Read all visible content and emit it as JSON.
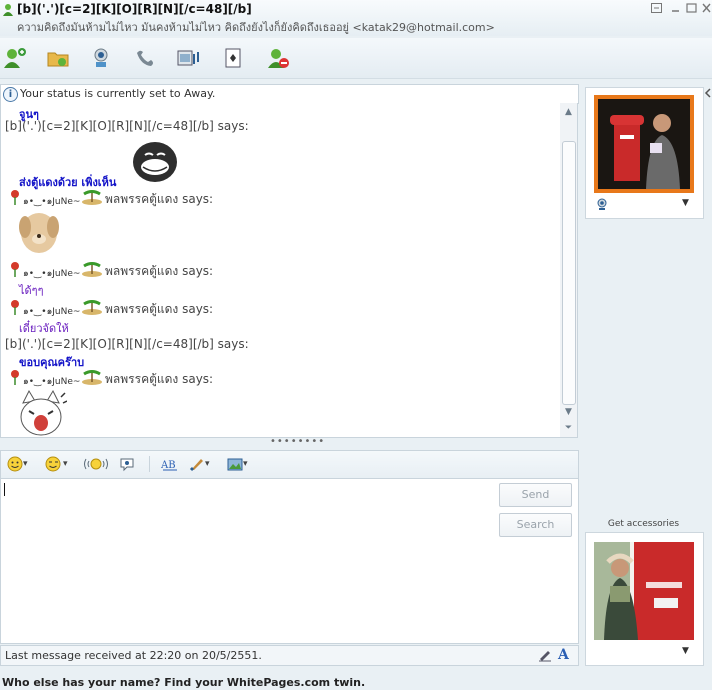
{
  "window": {
    "title": "[b]('.')[c=2][K][O][R][N][/c=48][/b]",
    "subtitle": "ความคิดถึงมันห้ามไม่ไหว มันคงห้ามไม่ไหว คิดถึงยังไงก็ยังคิดถึงเธออยู่ <katak29@hotmail.com>",
    "controls": [
      "restore-icon",
      "minimize-icon",
      "maximize-icon",
      "close-icon"
    ]
  },
  "toolbar": {
    "buttons": [
      {
        "name": "invite-contact",
        "icon": "add-contact-icon"
      },
      {
        "name": "send-files",
        "icon": "folder-icon"
      },
      {
        "name": "video-call",
        "icon": "webcam-icon"
      },
      {
        "name": "voice-call",
        "icon": "phone-icon"
      },
      {
        "name": "activities",
        "icon": "film-icon"
      },
      {
        "name": "games",
        "icon": "playing-card-icon"
      },
      {
        "name": "block",
        "icon": "block-contact-icon"
      }
    ]
  },
  "status": {
    "text": "Your status is currently set to Away."
  },
  "conversation": {
    "me_says": "[b]('.')[c=2][K][O][R][N][/c=48][/b] says:",
    "contact_name": "๑•‿•๑JuNe~",
    "contact_says": "พลพรรคตู้แดง says:",
    "messages": {
      "m1": "จูนๆ",
      "m2": "ส่งตู้แดงด้วย เพิ่งเห็น",
      "m3": "ได้ๆๆ",
      "m4": "เดี๋ยวจัดให้",
      "m5": "ขอบคุณคร๊าบ"
    }
  },
  "format_toolbar": {
    "buttons": [
      "emoticon-icon",
      "wink-icon",
      "nudge-icon",
      "voice-clip-icon",
      "text-format-icon",
      "background-icon",
      "picture-icon"
    ]
  },
  "compose": {
    "send_label": "Send",
    "search_label": "Search"
  },
  "footer": {
    "last_message": "Last message received at 22:20 on 20/5/2551."
  },
  "sidebar": {
    "get_accessories": "Get accessories"
  },
  "ad": {
    "text": "Who else has your name? Find your WhitePages.com twin."
  },
  "colors": {
    "bold_message": "#1414c8",
    "plain_message": "#6a1fbf",
    "window_bg": "#e9f0f4"
  }
}
